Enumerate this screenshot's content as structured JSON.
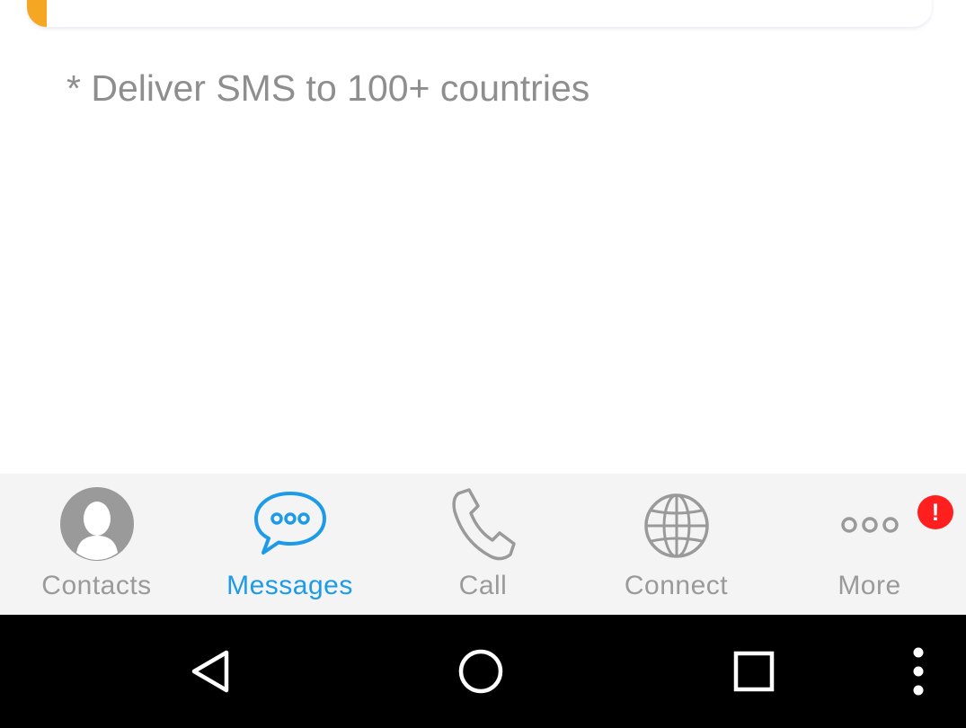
{
  "content": {
    "note": "* Deliver SMS to 100+ countries"
  },
  "tabs": [
    {
      "label": "Contacts",
      "icon": "person-icon",
      "active": false
    },
    {
      "label": "Messages",
      "icon": "chat-bubble-icon",
      "active": true
    },
    {
      "label": "Call",
      "icon": "phone-icon",
      "active": false
    },
    {
      "label": "Connect",
      "icon": "globe-icon",
      "active": false
    },
    {
      "label": "More",
      "icon": "more-dots-icon",
      "active": false
    }
  ],
  "more_badge": "!",
  "system_nav": {
    "back": "back-triangle-icon",
    "home": "home-circle-icon",
    "recents": "recents-square-icon",
    "menu": "overflow-menu-icon"
  },
  "colors": {
    "active_tab": "#1e9be8",
    "inactive_tab": "#9a9a9a",
    "accent": "#f5a623",
    "badge": "#ff1f1f"
  }
}
